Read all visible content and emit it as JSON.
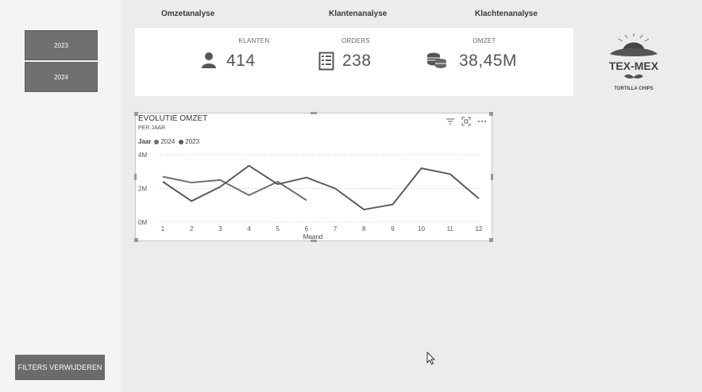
{
  "sidebar": {
    "year_buttons": [
      "2023",
      "2024"
    ],
    "filters_button": "FILTERS VERWIJDEREN"
  },
  "nav": {
    "tabs": [
      "Omzetanalyse",
      "Klantenanalyse",
      "Klachtenanalyse"
    ]
  },
  "kpis": [
    {
      "label": "KLANTEN",
      "value": "414",
      "icon": "person-icon"
    },
    {
      "label": "ORDERS",
      "value": "238",
      "icon": "list-icon"
    },
    {
      "label": "OMZET",
      "value": "38,45M",
      "icon": "coins-icon"
    }
  ],
  "logo": {
    "line1": "TEX-MEX",
    "line2": "TORTILLA CHIPS"
  },
  "colors": {
    "series_2024": "#6e6e6e",
    "series_2023": "#5a5a5a"
  },
  "chart_data": {
    "type": "line",
    "title": "EVOLUTIE OMZET",
    "subtitle": "PER JAAR",
    "legend_title": "Jaar",
    "xlabel": "Maand",
    "ylabel": "",
    "x": [
      1,
      2,
      3,
      4,
      5,
      6,
      7,
      8,
      9,
      10,
      11,
      12
    ],
    "y_ticks": [
      "4M",
      "2M",
      "0M"
    ],
    "ylim": [
      0,
      4
    ],
    "grid": true,
    "legend_position": "top-left",
    "series": [
      {
        "name": "2024",
        "values": [
          2.7,
          2.35,
          2.5,
          1.6,
          2.4,
          1.3,
          null,
          null,
          null,
          null,
          null,
          null
        ]
      },
      {
        "name": "2023",
        "values": [
          2.4,
          1.25,
          2.1,
          3.35,
          2.25,
          2.65,
          2.0,
          0.75,
          1.05,
          3.2,
          2.85,
          1.4
        ]
      }
    ]
  }
}
